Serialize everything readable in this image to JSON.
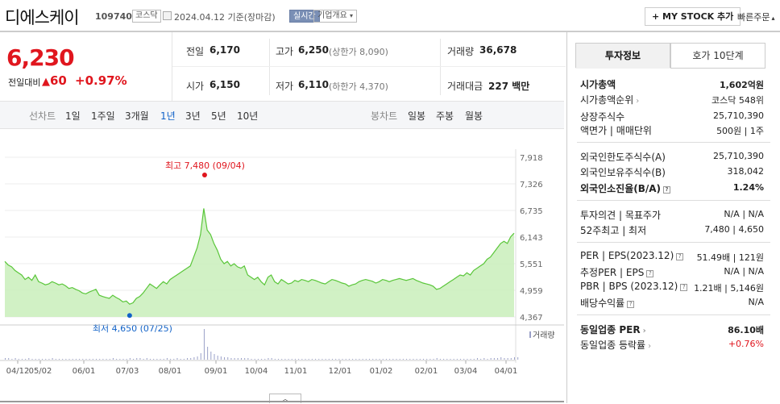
{
  "header": {
    "company_name": "디에스케이",
    "code": "109740",
    "market": "코스닥",
    "date_text": "2024.04.12 기준(장마감)",
    "realtime": "실시간",
    "overview": "기업개요",
    "overview_icon": "chevron-down-icon",
    "my_stock": "+ MY STOCK 추가",
    "quick_order": "빠른주문"
  },
  "summary": {
    "price": "6,230",
    "change_label": "전일대비",
    "change_value": "60",
    "change_percent": "+0.97%",
    "direction": "up",
    "colors": {
      "up": "#e0161e",
      "down": "#1162c8"
    }
  },
  "stats": {
    "prev_label": "전일",
    "prev_value": "6,170",
    "high_label": "고가",
    "high_value": "6,250",
    "upper_limit": "(상한가 8,090)",
    "volume_label": "거래량",
    "volume_value": "36,678",
    "open_label": "시가",
    "open_value": "6,150",
    "low_label": "저가",
    "low_value": "6,110",
    "lower_limit": "(하한가 4,370)",
    "amount_label": "거래대금",
    "amount_value": "227 백만"
  },
  "periods": {
    "line_label": "선차트",
    "items": [
      "1일",
      "1주일",
      "3개월",
      "1년",
      "3년",
      "5년",
      "10년"
    ],
    "selected": "1년",
    "candle_label": "봉차트",
    "candle_items": [
      "일봉",
      "주봉",
      "월봉"
    ]
  },
  "chart_data": {
    "type": "area",
    "x_ticks": [
      "04/12",
      "05/02",
      "06/01",
      "07/03",
      "08/01",
      "09/01",
      "10/04",
      "11/01",
      "12/01",
      "01/02",
      "02/01",
      "03/04",
      "04/01"
    ],
    "y_ticks": [
      "7,918",
      "7,326",
      "6,735",
      "6,143",
      "5,551",
      "4,959",
      "4,367"
    ],
    "ylim": [
      4367,
      7918
    ],
    "values": [
      5600,
      5520,
      5480,
      5400,
      5350,
      5300,
      5200,
      5250,
      5180,
      5300,
      5150,
      5120,
      5080,
      5100,
      5150,
      5120,
      5080,
      5100,
      5060,
      5000,
      5020,
      4980,
      4950,
      4900,
      4880,
      4920,
      4950,
      4980,
      4850,
      4820,
      4800,
      4780,
      4850,
      4800,
      4760,
      4700,
      4720,
      4650,
      4680,
      4780,
      4820,
      4900,
      5000,
      5100,
      5050,
      5000,
      5080,
      5150,
      5100,
      5200,
      5250,
      5300,
      5350,
      5400,
      5450,
      5500,
      5700,
      5900,
      6200,
      6780,
      6300,
      6200,
      6000,
      5850,
      5650,
      5550,
      5600,
      5500,
      5550,
      5480,
      5450,
      5500,
      5300,
      5250,
      5200,
      5250,
      5150,
      5080,
      5250,
      5300,
      5150,
      5100,
      5200,
      5150,
      5100,
      5120,
      5180,
      5150,
      5200,
      5180,
      5150,
      5200,
      5180,
      5150,
      5120,
      5100,
      5150,
      5200,
      5180,
      5150,
      5120,
      5100,
      5050,
      5080,
      5100,
      5150,
      5180,
      5200,
      5180,
      5160,
      5120,
      5150,
      5200,
      5180,
      5150,
      5180,
      5200,
      5220,
      5200,
      5180,
      5200,
      5220,
      5180,
      5150,
      5120,
      5100,
      5080,
      5050,
      4980,
      5000,
      5050,
      5100,
      5150,
      5200,
      5250,
      5300,
      5280,
      5350,
      5300,
      5400,
      5450,
      5500,
      5550,
      5650,
      5700,
      5800,
      5900,
      6000,
      6050,
      6000,
      6150,
      6230
    ],
    "volume": [
      2,
      2,
      1,
      2,
      1,
      1,
      1,
      2,
      1,
      1,
      1,
      1,
      1,
      1,
      2,
      1,
      1,
      1,
      1,
      1,
      1,
      1,
      1,
      1,
      1,
      1,
      1,
      1,
      1,
      1,
      1,
      1,
      2,
      1,
      1,
      1,
      1,
      2,
      1,
      2,
      2,
      1,
      2,
      1,
      1,
      1,
      1,
      1,
      2,
      1,
      1,
      2,
      1,
      1,
      2,
      2,
      3,
      4,
      8,
      38,
      16,
      10,
      7,
      5,
      4,
      3,
      3,
      2,
      2,
      2,
      2,
      2,
      2,
      1,
      1,
      1,
      1,
      1,
      2,
      2,
      1,
      1,
      1,
      1,
      1,
      1,
      1,
      1,
      1,
      1,
      1,
      1,
      1,
      1,
      1,
      1,
      1,
      1,
      1,
      1,
      1,
      1,
      1,
      1,
      1,
      1,
      1,
      1,
      1,
      1,
      1,
      1,
      1,
      1,
      1,
      1,
      1,
      1,
      1,
      1,
      1,
      1,
      1,
      1,
      1,
      1,
      1,
      1,
      2,
      1,
      1,
      1,
      1,
      1,
      1,
      1,
      1,
      1,
      1,
      1,
      2,
      1,
      2,
      1,
      2,
      2,
      2,
      3,
      2,
      2,
      2,
      3,
      3
    ],
    "high_label": "최고 7,480 (09/04)",
    "low_label": "최저 4,650 (07/25)",
    "volume_label": "거래량",
    "line_color": "#5ac63a",
    "fill_color": "#c9efbb"
  },
  "right": {
    "tabs": [
      "투자정보",
      "호가 10단계"
    ],
    "rows": [
      {
        "label": "시가총액",
        "value": "1,602억원",
        "bold": true
      },
      {
        "label": "시가총액순위",
        "value": "코스닥 548위",
        "arrow": true
      },
      {
        "label": "상장주식수",
        "value": "25,710,390"
      },
      {
        "label": "액면가 | 매매단위",
        "value": "500원 | 1주"
      },
      {
        "label": "외국인한도주식수(A)",
        "value": "25,710,390"
      },
      {
        "label": "외국인보유주식수(B)",
        "value": "318,042"
      },
      {
        "label": "외국인소진율(B/A)",
        "value": "1.24%",
        "bold": true,
        "q": true
      },
      {
        "label": "투자의견 | 목표주가",
        "value": "N/A | N/A"
      },
      {
        "label": "52주최고 | 최저",
        "value": "7,480 | 4,650"
      },
      {
        "label": "PER | EPS(2023.12)",
        "value": "51.49배 | 121원",
        "q": true
      },
      {
        "label": "추정PER | EPS",
        "value": "N/A | N/A",
        "q": true
      },
      {
        "label": "PBR | BPS (2023.12)",
        "value": "1.21배 | 5,146원",
        "q": true
      },
      {
        "label": "배당수익률",
        "value": "N/A",
        "q": true
      },
      {
        "label": "동일업종 PER",
        "value": "86.10배",
        "bold": true,
        "arrow": true
      },
      {
        "label": "동일업종 등락률",
        "value": "+0.76%",
        "arrow": true,
        "red": true
      }
    ]
  },
  "collapse_icon": "chevron-up-icon"
}
